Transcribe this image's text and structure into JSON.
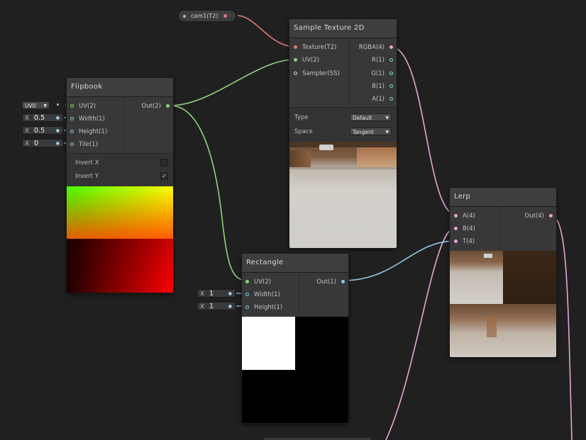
{
  "property_pill": {
    "label": "cam1(T2)"
  },
  "sample_texture": {
    "title": "Sample Texture 2D",
    "inputs": [
      "Texture(T2)",
      "UV(2)",
      "Sampler(SS)"
    ],
    "outputs": [
      "RGBA(4)",
      "R(1)",
      "G(1)",
      "B(1)",
      "A(1)"
    ],
    "type_label": "Type",
    "type_value": "Default",
    "space_label": "Space",
    "space_value": "Tangent"
  },
  "flipbook": {
    "title": "Flipbook",
    "inputs": [
      "UV(2)",
      "Width(1)",
      "Height(1)",
      "Tile(1)"
    ],
    "output": "Out(2)",
    "invert_x_label": "Invert X",
    "invert_x": false,
    "invert_y_label": "Invert Y",
    "invert_y": true,
    "uv_dropdown": "UV0",
    "width_field": {
      "axis": "X",
      "value": "0.5"
    },
    "height_field": {
      "axis": "X",
      "value": "0.5"
    },
    "tile_field": {
      "axis": "X",
      "value": "0"
    }
  },
  "rectangle": {
    "title": "Rectangle",
    "inputs": [
      "UV(2)",
      "Width(1)",
      "Height(1)"
    ],
    "output": "Out(1)",
    "width_field": {
      "axis": "X",
      "value": "1"
    },
    "height_field": {
      "axis": "X",
      "value": "1"
    }
  },
  "lerp": {
    "title": "Lerp",
    "inputs": [
      "A(4)",
      "B(4)",
      "T(4)"
    ],
    "output": "Out(4)"
  },
  "colors": {
    "wire_texture": "#e07a78",
    "wire_vec2": "#8fd27f",
    "wire_vec1": "#8fc9dd",
    "wire_vec4": "#e4a6d6"
  }
}
